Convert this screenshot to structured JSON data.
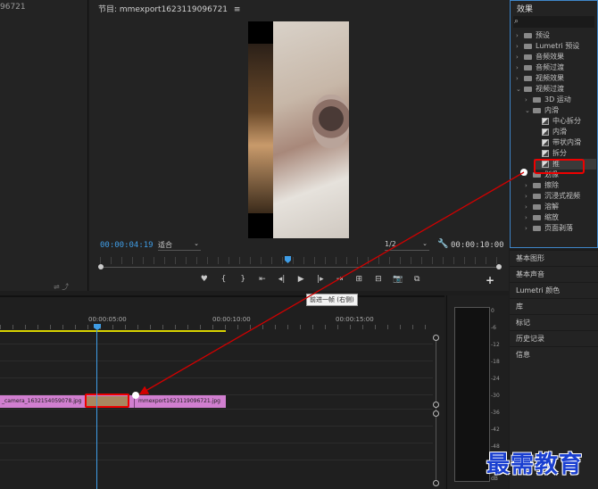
{
  "source_panel": {
    "title": "96721"
  },
  "program_monitor": {
    "title": "节目: mmexport1623119096721",
    "menu_glyph": "≡",
    "timecode": "00:00:04:19",
    "fit": "适合",
    "resolution": "1/2",
    "duration": "00:00:10:00",
    "controls": [
      "♥",
      "{",
      "}",
      "⇤",
      "◂|",
      "▶",
      "|▸",
      "⇥",
      "⊞",
      "⊟",
      "📷",
      "⧉"
    ],
    "plus": "+"
  },
  "effects_panel": {
    "title": "效果",
    "search_placeholder": "",
    "tree": [
      {
        "label": "预设",
        "level": 0,
        "arrow": "›"
      },
      {
        "label": "Lumetri 预设",
        "level": 0,
        "arrow": "›"
      },
      {
        "label": "音频效果",
        "level": 0,
        "arrow": "›"
      },
      {
        "label": "音频过渡",
        "level": 0,
        "arrow": "›"
      },
      {
        "label": "视频效果",
        "level": 0,
        "arrow": "›"
      },
      {
        "label": "视频过渡",
        "level": 0,
        "arrow": "⌄"
      },
      {
        "label": "3D 运动",
        "level": 1,
        "arrow": "›"
      },
      {
        "label": "内滑",
        "level": 1,
        "arrow": "⌄"
      },
      {
        "label": "中心拆分",
        "level": 2,
        "arrow": ""
      },
      {
        "label": "内滑",
        "level": 2,
        "arrow": ""
      },
      {
        "label": "带状内滑",
        "level": 2,
        "arrow": ""
      },
      {
        "label": "拆分",
        "level": 2,
        "arrow": ""
      },
      {
        "label": "推",
        "level": 2,
        "arrow": ""
      },
      {
        "label": "划像",
        "level": 1,
        "arrow": "›"
      },
      {
        "label": "擦除",
        "level": 1,
        "arrow": "›"
      },
      {
        "label": "沉浸式视频",
        "level": 1,
        "arrow": "›"
      },
      {
        "label": "溶解",
        "level": 1,
        "arrow": "›"
      },
      {
        "label": "缩放",
        "level": 1,
        "arrow": "›"
      },
      {
        "label": "页面剥落",
        "level": 1,
        "arrow": "›"
      }
    ]
  },
  "side_panels": [
    "基本图形",
    "基本声音",
    "Lumetri 颜色",
    "库",
    "标记",
    "历史记录",
    "信息"
  ],
  "tooltip": "前进一帧 (右侧)",
  "timeline": {
    "times": [
      "00:00:05:00",
      "00:00:10:00",
      "00:00:15:00"
    ],
    "clip_a_label": "_camera_1632154059078.jpg",
    "clip_b_label": "mmexport1623119096721.jpg"
  },
  "audio_meter": {
    "labels": [
      "0",
      "-6",
      "-12",
      "-18",
      "-24",
      "-30",
      "-36",
      "-42",
      "-48",
      "-54",
      "dB"
    ]
  },
  "watermark": "最需教育",
  "colors": {
    "accent_blue": "#3f9de6",
    "highlight_red": "#e00000",
    "clip_pink": "#d17fd0",
    "work_area": "#d8d200"
  }
}
